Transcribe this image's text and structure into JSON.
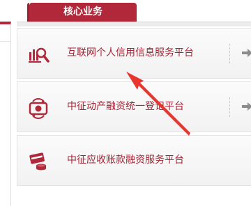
{
  "section": {
    "title": "核心业务"
  },
  "services": [
    {
      "label": "互联网个人信用信息服务平台",
      "icon": "magnifier-chart-icon"
    },
    {
      "label": "中征动产融资统一登记平台",
      "icon": "money-cycle-icon"
    },
    {
      "label": "中征应收账款融资服务平台",
      "icon": "card-coins-icon"
    }
  ],
  "colors": {
    "brand": "#b0283a",
    "label": "#a32536",
    "annotation": "#e8362f"
  }
}
